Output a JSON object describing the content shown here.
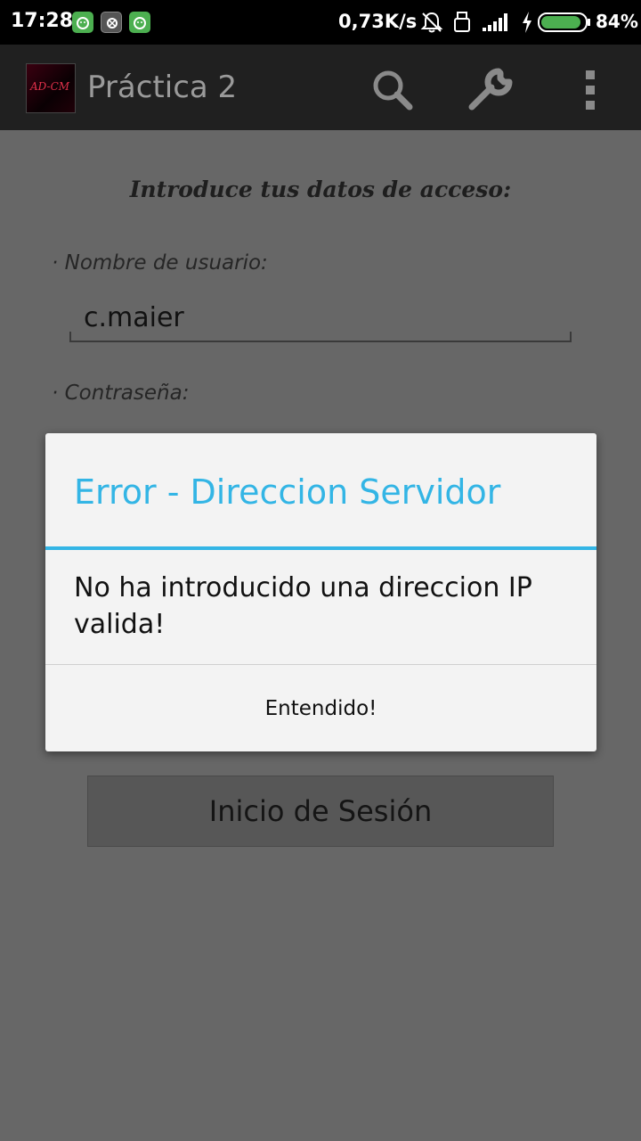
{
  "status_bar": {
    "time": "17:28",
    "net_speed": "0,73K/s",
    "battery": "84%"
  },
  "action_bar": {
    "logo_text": "AD-CM",
    "title": "Práctica 2",
    "icons": [
      "search-icon",
      "wrench-icon",
      "overflow-menu-icon"
    ]
  },
  "form": {
    "heading": "Introduce tus datos de acceso:",
    "username_label": "· Nombre de usuario:",
    "username_value": "c.maier",
    "password_label": "· Contraseña:",
    "login_button": "Inicio de Sesión"
  },
  "dialog": {
    "title": "Error - Direccion Servidor",
    "message": "No ha introducido una direccion IP valida!",
    "button": "Entendido!"
  },
  "colors": {
    "accent": "#33b5e5",
    "overlay_bg": "#676767",
    "battery_fill": "#4caf50"
  }
}
